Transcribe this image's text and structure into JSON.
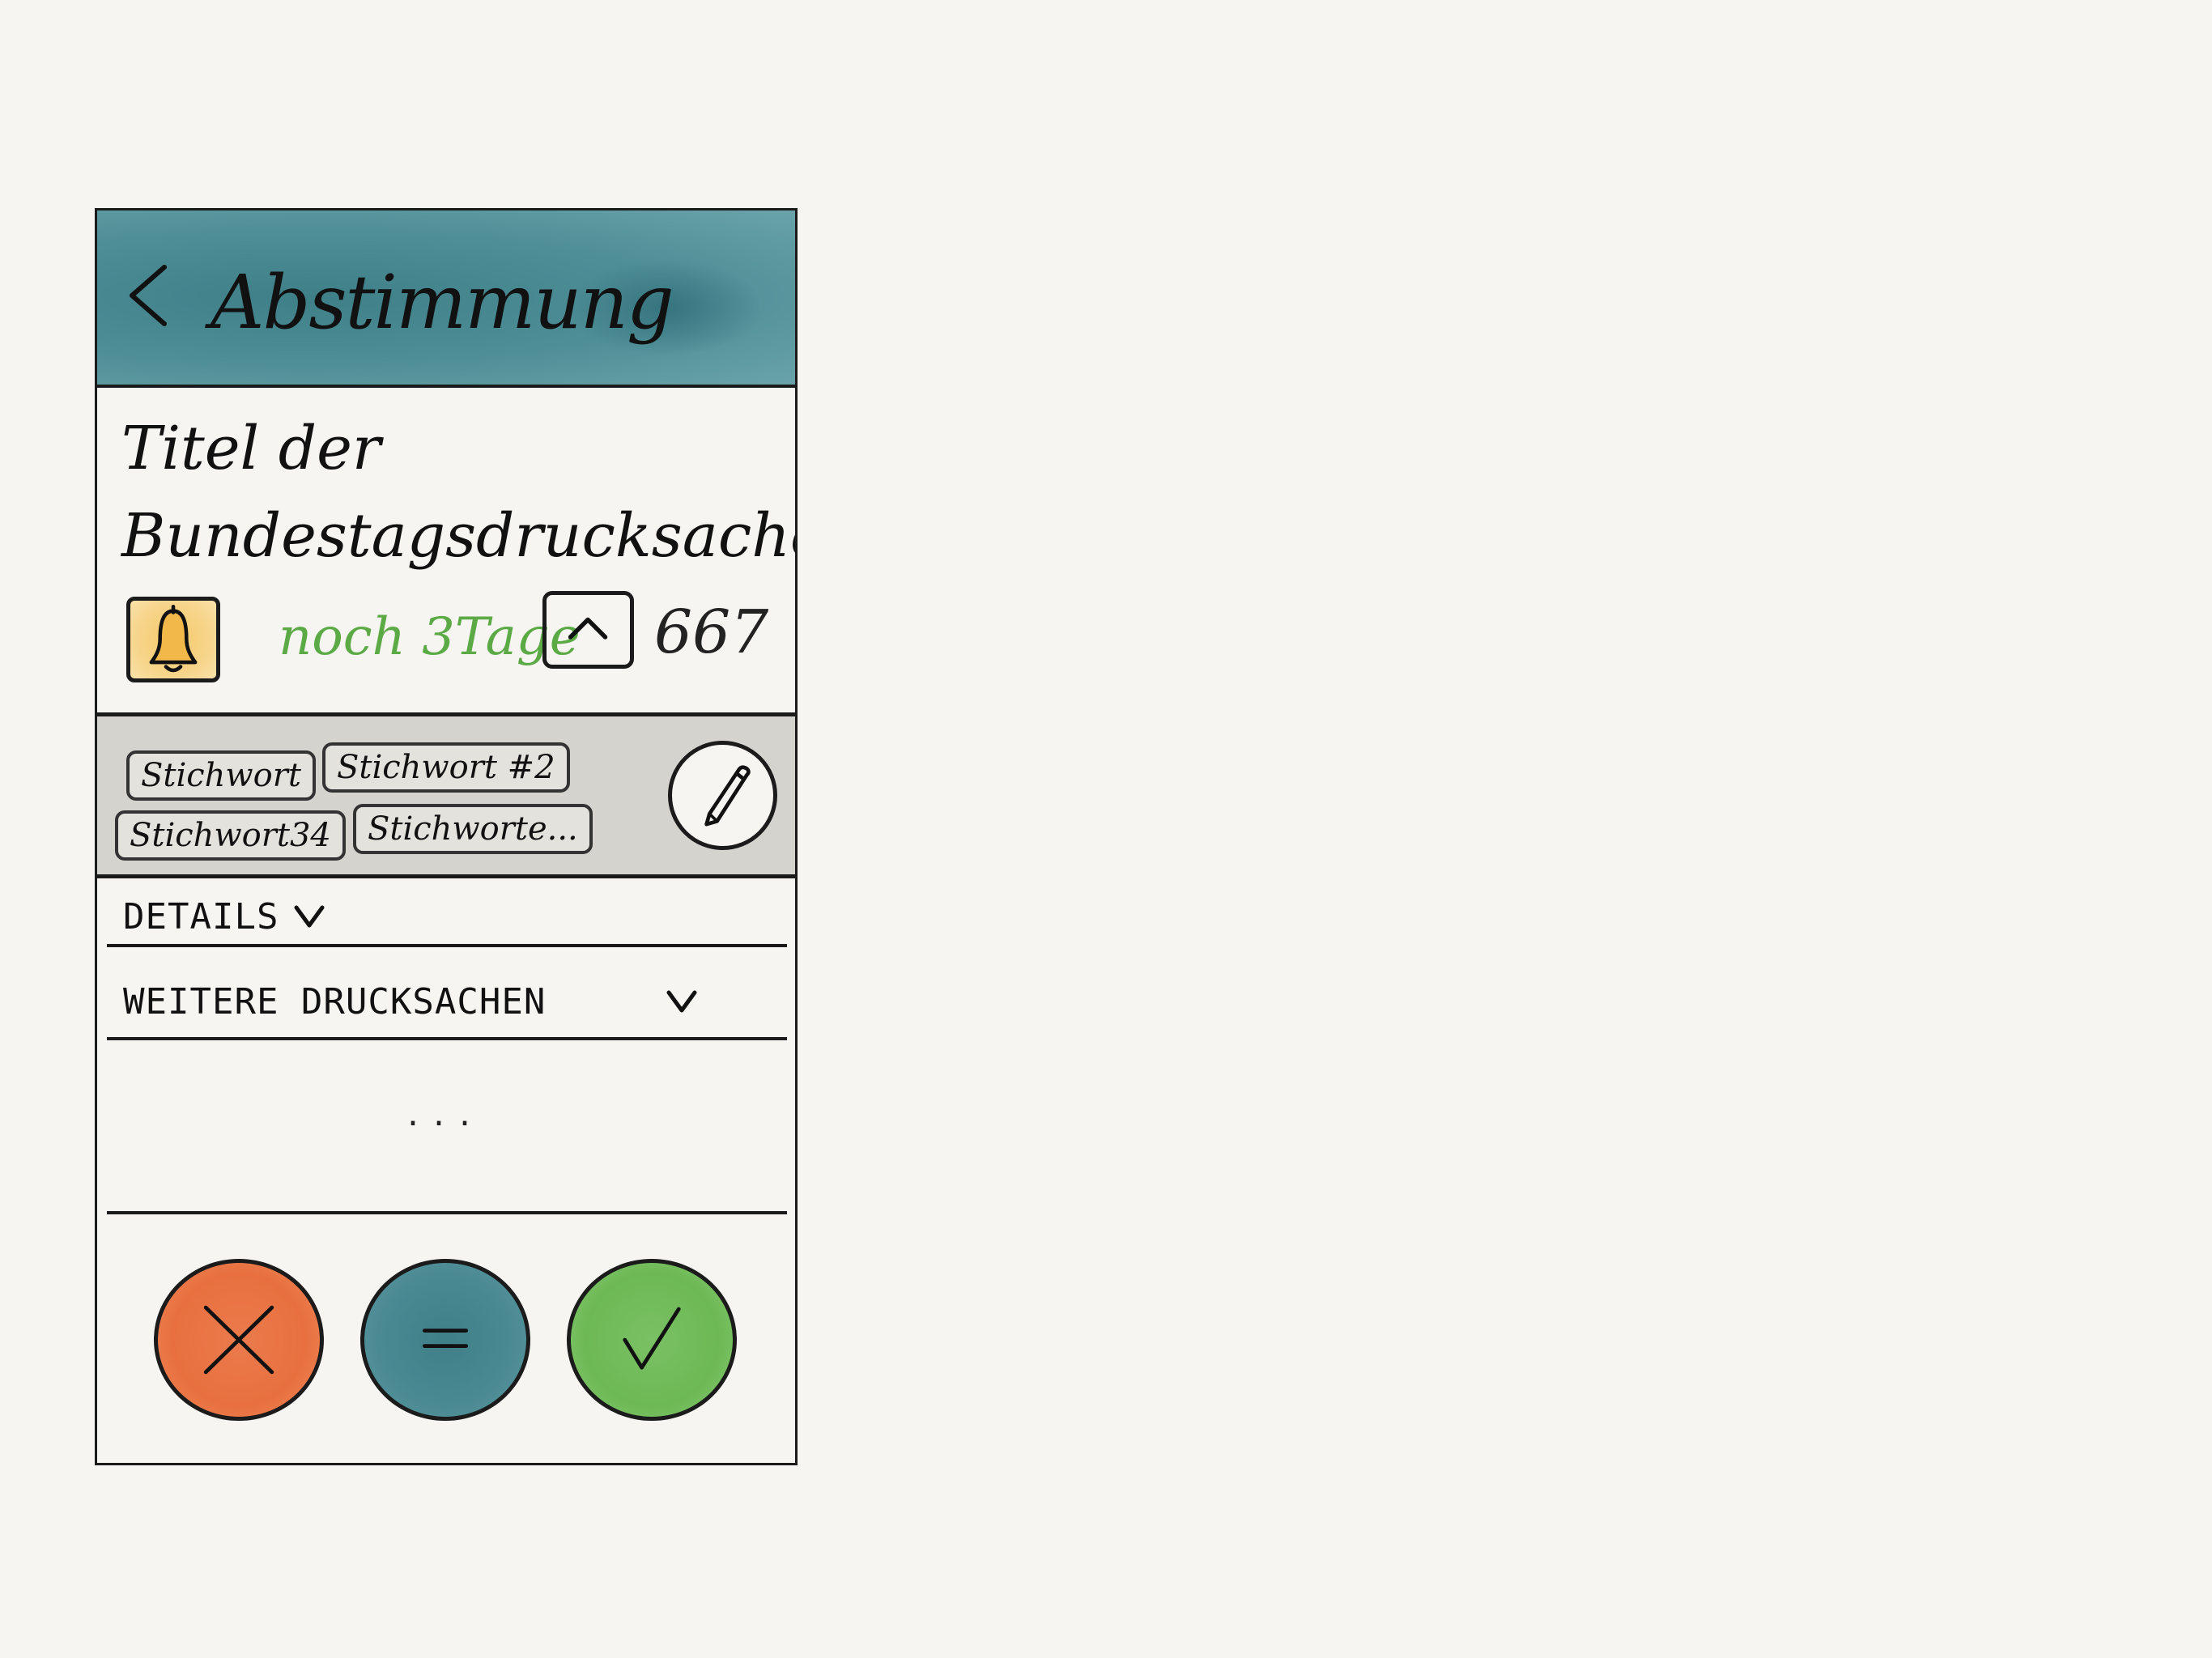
{
  "header": {
    "title": "Abstimmung"
  },
  "document": {
    "title": "Titel der Bundestagsdrucksache"
  },
  "status": {
    "deadline": "noch 3Tage",
    "vote_count": "667"
  },
  "tags": [
    "Stichwort",
    "Stichwort #2",
    "Stichwort34",
    "Stichworte..."
  ],
  "sections": {
    "details_label": "DETAILS",
    "more_label": "WEITERE DRUCKSACHEN"
  },
  "placeholder": "...",
  "colors": {
    "header": "#4f8f98",
    "deadline": "#5caa46",
    "vote_no": "#e8703f",
    "vote_abstain": "#4a8a93",
    "vote_yes": "#6db955",
    "bell": "#f6c56a",
    "tags_bg": "#d4d3ce"
  },
  "icons": {
    "back": "chevron-left-icon",
    "bell": "bell-icon",
    "upvote": "chevron-up-icon",
    "edit": "pencil-icon",
    "expand": "chevron-down-icon",
    "no": "x-icon",
    "abstain": "equals-icon",
    "yes": "check-icon"
  }
}
